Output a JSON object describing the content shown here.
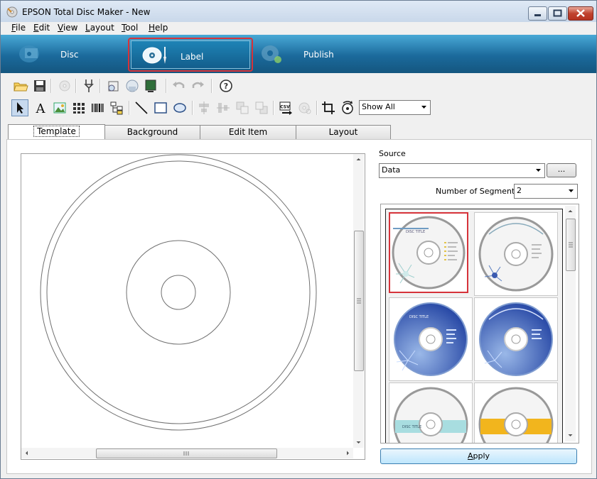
{
  "window": {
    "title": "EPSON Total Disc Maker - New"
  },
  "menu": [
    {
      "key": "F",
      "rest": "ile"
    },
    {
      "key": "E",
      "rest": "dit"
    },
    {
      "key": "V",
      "rest": "iew"
    },
    {
      "key": "L",
      "rest": "ayout"
    },
    {
      "key": "T",
      "rest": "ool"
    },
    {
      "key": "H",
      "rest": "elp"
    }
  ],
  "modes": {
    "disc": "Disc",
    "label": "Label",
    "publish": "Publish",
    "selected": "Label"
  },
  "toolbar": {
    "show_select": "Show All"
  },
  "tabs": [
    "Template",
    "Background",
    "Edit Item",
    "Layout"
  ],
  "active_tab": "Template",
  "side": {
    "source_label": "Source",
    "source_value": "Data",
    "browse_button": "...",
    "segments_label": "Number of Segments",
    "segments_value": "2",
    "apply_key": "A",
    "apply_rest": "pply"
  },
  "templates": [
    {
      "name": "template-1",
      "style": "light",
      "selected": true
    },
    {
      "name": "template-2",
      "style": "light-curved"
    },
    {
      "name": "template-3",
      "style": "blue"
    },
    {
      "name": "template-4",
      "style": "blue-curved"
    },
    {
      "name": "template-5",
      "style": "teal-band"
    },
    {
      "name": "template-6",
      "style": "yellow-band"
    }
  ],
  "colors": {
    "accent": "#1e84b6",
    "selection": "#d6333a"
  }
}
